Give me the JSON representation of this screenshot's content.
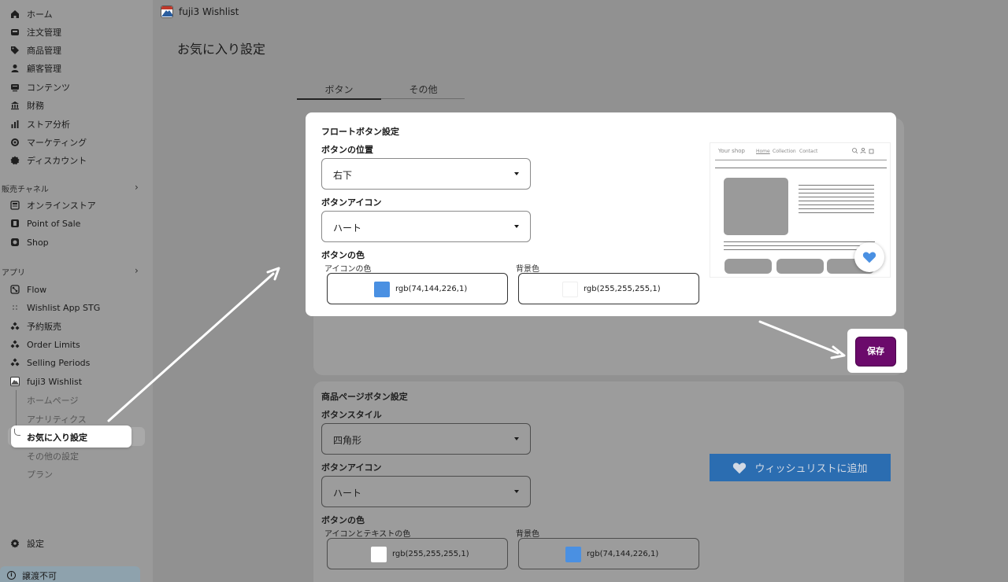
{
  "app": {
    "name": "fuji3 Wishlist"
  },
  "page": {
    "title": "お気に入り設定"
  },
  "sidebar": {
    "main_items": [
      {
        "label": "ホーム",
        "icon": "home-icon"
      },
      {
        "label": "注文管理",
        "icon": "inbox-icon"
      },
      {
        "label": "商品管理",
        "icon": "tag-icon"
      },
      {
        "label": "顧客管理",
        "icon": "person-icon"
      },
      {
        "label": "コンテンツ",
        "icon": "content-icon"
      },
      {
        "label": "財務",
        "icon": "bank-icon"
      },
      {
        "label": "ストア分析",
        "icon": "bar-chart-icon"
      },
      {
        "label": "マーケティング",
        "icon": "target-icon"
      },
      {
        "label": "ディスカウント",
        "icon": "discount-icon"
      }
    ],
    "sales_channels": {
      "title": "販売チャネル",
      "items": [
        {
          "label": "オンラインストア",
          "icon": "store-icon"
        },
        {
          "label": "Point of Sale",
          "icon": "pos-icon"
        },
        {
          "label": "Shop",
          "icon": "shop-icon"
        }
      ]
    },
    "apps": {
      "title": "アプリ",
      "items": [
        {
          "label": "Flow",
          "icon": "flow-icon"
        },
        {
          "label": "Wishlist App STG",
          "icon": "app-grid-icon"
        },
        {
          "label": "予約販売",
          "icon": "app-icon"
        },
        {
          "label": "Order Limits",
          "icon": "app-icon"
        },
        {
          "label": "Selling Periods",
          "icon": "app-icon"
        },
        {
          "label": "fuji3 Wishlist",
          "icon": "fuji-icon"
        }
      ],
      "sub_items": [
        "ホームページ",
        "アナリティクス",
        "お気に入り設定",
        "その他の設定",
        "プラン"
      ]
    },
    "settings": "設定",
    "bottom_notice": "譲渡不可"
  },
  "tabs": [
    {
      "label": "ボタン",
      "active": true
    },
    {
      "label": "その他",
      "active": false
    }
  ],
  "float_settings": {
    "title": "フロートボタン設定",
    "position_label": "ボタンの位置",
    "position_value": "右下",
    "icon_label": "ボタンアイコン",
    "icon_value": "ハート",
    "color_label": "ボタンの色",
    "icon_color_label": "アイコンの色",
    "icon_color_value": "rgb(74,144,226,1)",
    "icon_color_hex": "#4a90e2",
    "bg_color_label": "背景色",
    "bg_color_value": "rgb(255,255,255,1)",
    "bg_color_hex": "#ffffff"
  },
  "preview": {
    "shop_name": "Your shop",
    "nav_home": "Home",
    "nav_collection": "Collection",
    "nav_contact": "Contact"
  },
  "save_label": "保存",
  "product_settings": {
    "title": "商品ページボタン設定",
    "style_label": "ボタンスタイル",
    "style_value": "四角形",
    "icon_label": "ボタンアイコン",
    "icon_value": "ハート",
    "color_label": "ボタンの色",
    "icon_text_color_label": "アイコンとテキストの色",
    "icon_text_color_value": "rgb(255,255,255,1)",
    "icon_text_color_hex": "#ffffff",
    "bg_color_label": "背景色",
    "bg_color_value": "rgb(74,144,226,1)",
    "bg_color_hex": "#4a90e2",
    "wishlist_button_label": "ウィッシュリストに追加"
  }
}
